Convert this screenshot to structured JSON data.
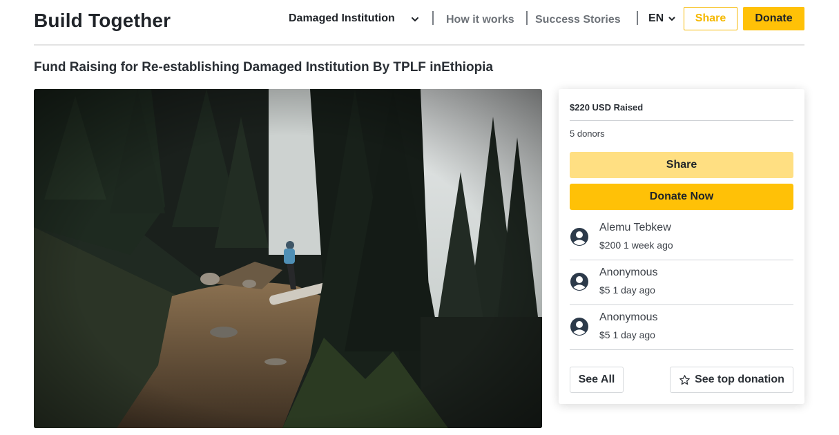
{
  "header": {
    "brand": "Build Together",
    "category_dropdown": "Damaged Institution",
    "nav": {
      "how_it_works": "How it works",
      "success_stories": "Success Stories"
    },
    "language": "EN",
    "share_label": "Share",
    "donate_label": "Donate"
  },
  "campaign": {
    "title": "Fund Raising for Re-establishing Damaged Institution By TPLF inEthiopia"
  },
  "sidebar": {
    "raised": "$220 USD Raised",
    "donors": "5 donors",
    "share_label": "Share",
    "donate_now_label": "Donate Now",
    "donations": [
      {
        "name": "Alemu Tebkew",
        "meta": "$200 1 week ago"
      },
      {
        "name": "Anonymous",
        "meta": "$5 1 day ago"
      },
      {
        "name": "Anonymous",
        "meta": "$5 1 day ago"
      }
    ],
    "see_all_label": "See All",
    "see_top_label": "See top donation"
  },
  "colors": {
    "accent": "#ffc107",
    "accent_light": "#ffdf82",
    "share_outline": "#f5b800",
    "text_dark": "#2a2f35",
    "nav_muted": "#6d7278"
  },
  "icons": [
    "chevron-down-icon",
    "user-avatar-icon",
    "star-outline-icon"
  ]
}
